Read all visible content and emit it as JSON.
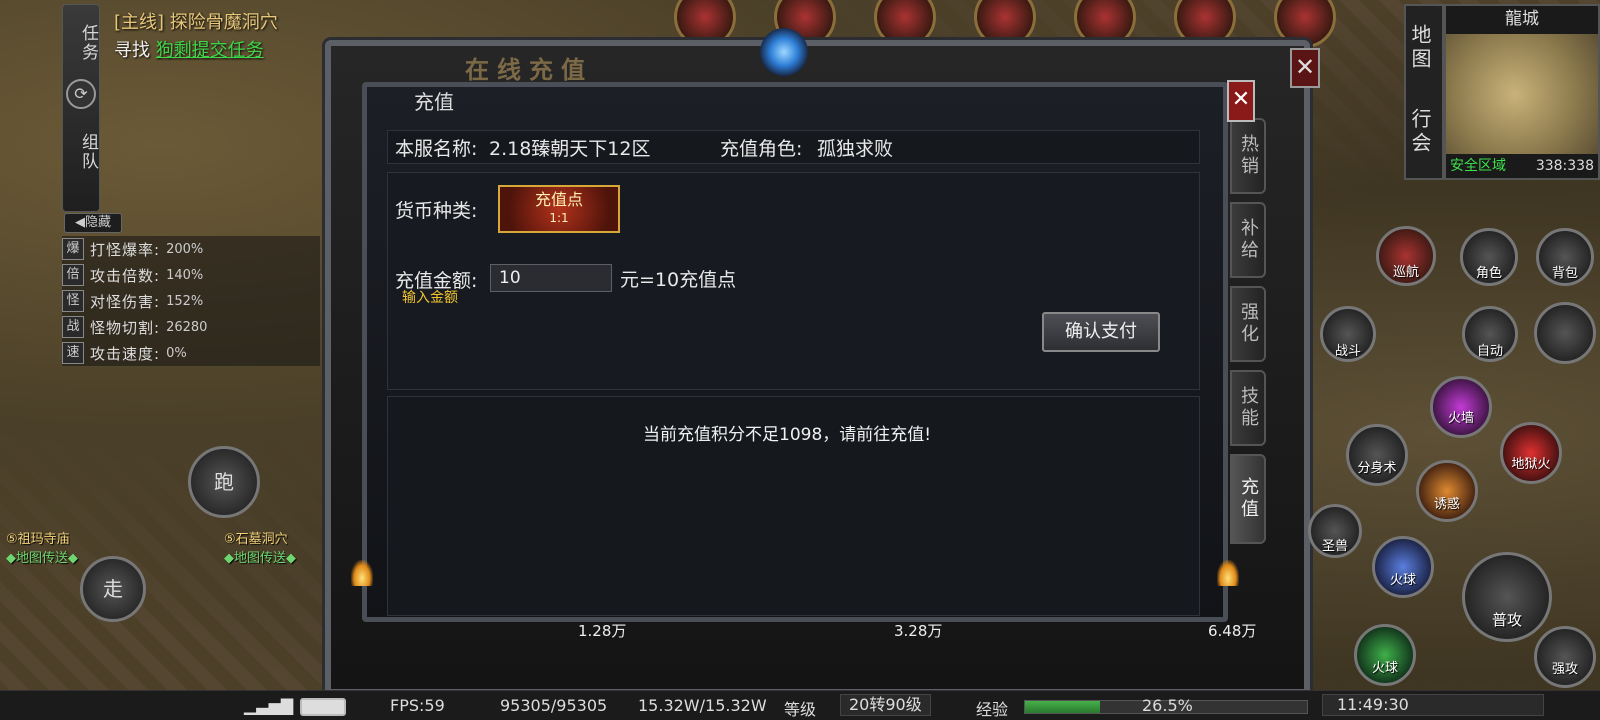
{
  "quest": {
    "tab_task": "任务",
    "tab_team": "组队",
    "main_line": "[主线] 探险骨魔洞穴",
    "find_prefix": "寻找",
    "find_target": "狗剩提交任务",
    "hide_label": "隐藏"
  },
  "stats": [
    {
      "tag": "爆",
      "label": "打怪爆率:",
      "value": "200%"
    },
    {
      "tag": "倍",
      "label": "攻击倍数:",
      "value": "140%"
    },
    {
      "tag": "怪",
      "label": "对怪伤害:",
      "value": "152%"
    },
    {
      "tag": "战",
      "label": "怪物切割:",
      "value": "26280"
    },
    {
      "tag": "速",
      "label": "攻击速度:",
      "value": "0%"
    }
  ],
  "movement": {
    "run": "跑",
    "walk": "走"
  },
  "portals": [
    {
      "name": "⑤祖玛寺庙",
      "sub": "◆地图传送◆"
    },
    {
      "name": "⑤石墓洞穴",
      "sub": "◆地图传送◆"
    }
  ],
  "outer_dialog": {
    "title": "在线充值",
    "close": "✕"
  },
  "side_tabs": [
    "热销",
    "补给",
    "强化",
    "技能",
    "充值"
  ],
  "recharge": {
    "title": "充值",
    "close": "✕",
    "server_label": "本服名称:",
    "server_value": "2.18臻朝天下12区",
    "role_label": "充值角色:",
    "role_value": "孤独求败",
    "currency_label": "货币种类:",
    "currency_option": "充值点",
    "currency_ratio": "1:1",
    "amount_label": "充值金额:",
    "amount_value": "10",
    "amount_hint": "输入金额",
    "rate_text": "元=10充值点",
    "confirm_button": "确认支付",
    "notice": "当前充值积分不足1098，请前往充值!"
  },
  "tray_amounts": [
    "1.28万",
    "3.28万",
    "6.48万"
  ],
  "minimap": {
    "tab_map": "地图",
    "tab_guild": "行会",
    "title": "龍城",
    "zone": "安全区域",
    "coords": "338:338"
  },
  "skills": {
    "patrol": "巡航",
    "role": "角色",
    "bag": "背包",
    "battle": "战斗",
    "auto": "自动",
    "hellfire": "地狱火",
    "firewall": "火墙",
    "clone": "分身术",
    "lure": "诱惑",
    "fireball_big": "火球",
    "normal_attack": "普攻",
    "fireball": "火球",
    "strong_attack": "强攻",
    "summon": "圣兽"
  },
  "status_bar": {
    "fps": "FPS:59",
    "hp": "95305/95305",
    "mp": "15.32W/15.32W",
    "level_label": "等级",
    "level_value": "20转90级",
    "exp_label": "经验",
    "exp_percent": "26.5%",
    "exp_fraction": 0.265,
    "time": "11:49:30"
  },
  "colors": {
    "quest_link": "#3fd64a",
    "safe_zone": "#3fe04b",
    "hint": "#f3c531",
    "currency_border": "#d6a83a"
  }
}
